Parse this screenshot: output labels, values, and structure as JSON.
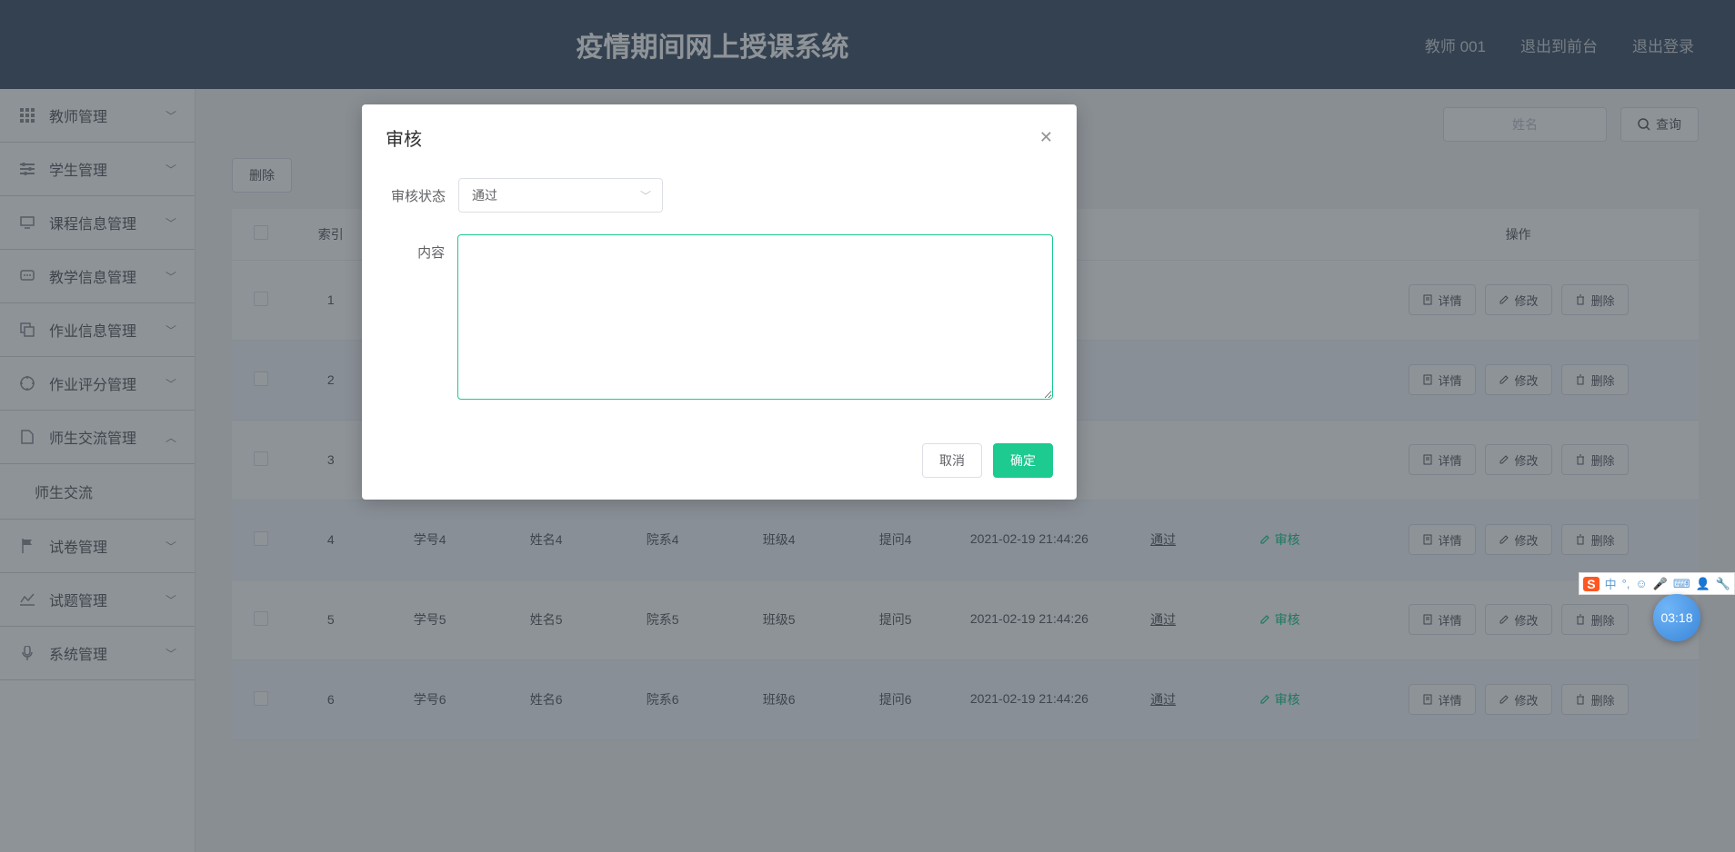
{
  "header": {
    "title": "疫情期间网上授课系统",
    "user": "教师 001",
    "to_front": "退出到前台",
    "logout": "退出登录"
  },
  "sidebar": {
    "items": [
      {
        "label": "教师管理",
        "icon": "grid"
      },
      {
        "label": "学生管理",
        "icon": "sliders"
      },
      {
        "label": "课程信息管理",
        "icon": "monitor"
      },
      {
        "label": "教学信息管理",
        "icon": "message"
      },
      {
        "label": "作业信息管理",
        "icon": "copy"
      },
      {
        "label": "作业评分管理",
        "icon": "target"
      },
      {
        "label": "师生交流管理",
        "icon": "file",
        "expanded": true,
        "children": [
          "师生交流"
        ]
      },
      {
        "label": "试卷管理",
        "icon": "flag"
      },
      {
        "label": "试题管理",
        "icon": "chart"
      },
      {
        "label": "系统管理",
        "icon": "mic"
      }
    ]
  },
  "toolbar": {
    "delete": "删除",
    "name_placeholder": "姓名",
    "query": "查询"
  },
  "table": {
    "headers": {
      "index": "索引",
      "actions": "操作"
    },
    "rows": [
      {
        "i": "1",
        "sid": "",
        "name": "",
        "dept": "",
        "cls": "",
        "q": "",
        "time": "",
        "status": "",
        "review": ""
      },
      {
        "i": "2",
        "sid": "",
        "name": "",
        "dept": "",
        "cls": "",
        "q": "",
        "time": "",
        "status": "",
        "review": ""
      },
      {
        "i": "3",
        "sid": "",
        "name": "",
        "dept": "",
        "cls": "",
        "q": "",
        "time": "",
        "status": "",
        "review": ""
      },
      {
        "i": "4",
        "sid": "学号4",
        "name": "姓名4",
        "dept": "院系4",
        "cls": "班级4",
        "q": "提问4",
        "time": "2021-02-19 21:44:26",
        "status": "通过",
        "review": "审核"
      },
      {
        "i": "5",
        "sid": "学号5",
        "name": "姓名5",
        "dept": "院系5",
        "cls": "班级5",
        "q": "提问5",
        "time": "2021-02-19 21:44:26",
        "status": "通过",
        "review": "审核"
      },
      {
        "i": "6",
        "sid": "学号6",
        "name": "姓名6",
        "dept": "院系6",
        "cls": "班级6",
        "q": "提问6",
        "time": "2021-02-19 21:44:26",
        "status": "通过",
        "review": "审核"
      }
    ],
    "btn": {
      "detail": "详情",
      "edit": "修改",
      "del": "删除"
    }
  },
  "modal": {
    "title": "审核",
    "status_label": "审核状态",
    "status_value": "通过",
    "content_label": "内容",
    "content_value": "",
    "cancel": "取消",
    "confirm": "确定"
  },
  "ime": {
    "indicator": "中",
    "time": "03:18"
  }
}
